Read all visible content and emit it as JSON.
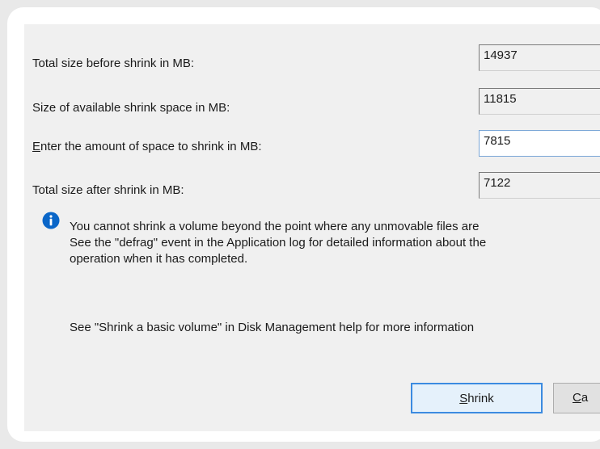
{
  "fields": [
    {
      "label": "Total size before shrink in MB:",
      "value": "14937",
      "editable": false
    },
    {
      "label": "Size of available shrink space in MB:",
      "value": "11815",
      "editable": false
    },
    {
      "label_mnemonic": "E",
      "label_rest": "nter the amount of space to shrink in MB:",
      "value": "7815",
      "editable": true
    },
    {
      "label": "Total size after shrink in MB:",
      "value": "7122",
      "editable": false
    }
  ],
  "info": {
    "icon": "info-icon",
    "lines": [
      "You cannot shrink a volume beyond the point where any unmovable files are",
      "See the \"defrag\" event in the Application log for detailed information about the",
      "operation when it has completed."
    ]
  },
  "help_text": "See \"Shrink a basic volume\" in Disk Management help for more information",
  "buttons": {
    "shrink_mnemonic": "S",
    "shrink_rest": "hrink",
    "cancel_mnemonic": "C",
    "cancel_rest": "a"
  },
  "colors": {
    "dialog_bg": "#f0f0f0",
    "info_icon": "#0a66c8",
    "shrink_border": "#3c8be0"
  }
}
